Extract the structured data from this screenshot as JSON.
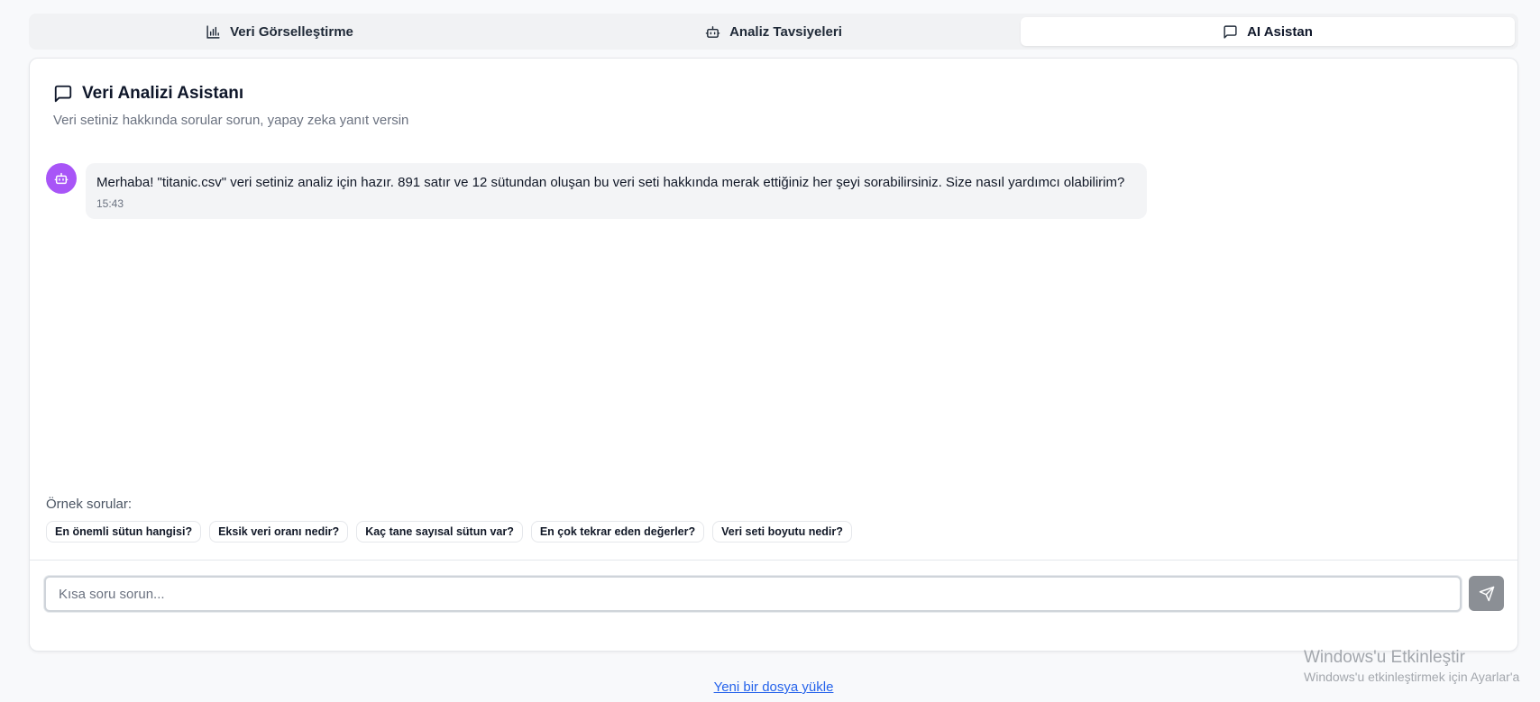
{
  "tabs": [
    {
      "label": "Veri Görselleştirme",
      "icon": "bar-chart-icon",
      "active": false
    },
    {
      "label": "Analiz Tavsiyeleri",
      "icon": "bot-icon",
      "active": false
    },
    {
      "label": "AI Asistan",
      "icon": "message-square-icon",
      "active": true
    }
  ],
  "card": {
    "title": "Veri Analizi Asistanı",
    "subtitle": "Veri setiniz hakkında sorular sorun, yapay zeka yanıt versin"
  },
  "messages": [
    {
      "sender": "assistant",
      "avatar_icon": "bot-icon",
      "avatar_color": "#a855f7",
      "text": "Merhaba! \"titanic.csv\" veri setiniz analiz için hazır. 891 satır ve 12 sütundan oluşan bu veri seti hakkında merak ettiğiniz her şeyi sorabilirsiniz. Size nasıl yardımcı olabilirim?",
      "time": "15:43"
    }
  ],
  "examples": {
    "label": "Örnek sorular:",
    "items": [
      "En önemli sütun hangisi?",
      "Eksik veri oranı nedir?",
      "Kaç tane sayısal sütun var?",
      "En çok tekrar eden değerler?",
      "Veri seti boyutu nedir?"
    ]
  },
  "input": {
    "placeholder": "Kısa soru sorun...",
    "value": "",
    "send_icon": "send-icon"
  },
  "footer": {
    "upload_link": "Yeni bir dosya yükle"
  },
  "watermark": {
    "title": "Windows'u Etkinleştir",
    "subtitle": "Windows'u etkinleştirmek için Ayarlar'a"
  }
}
